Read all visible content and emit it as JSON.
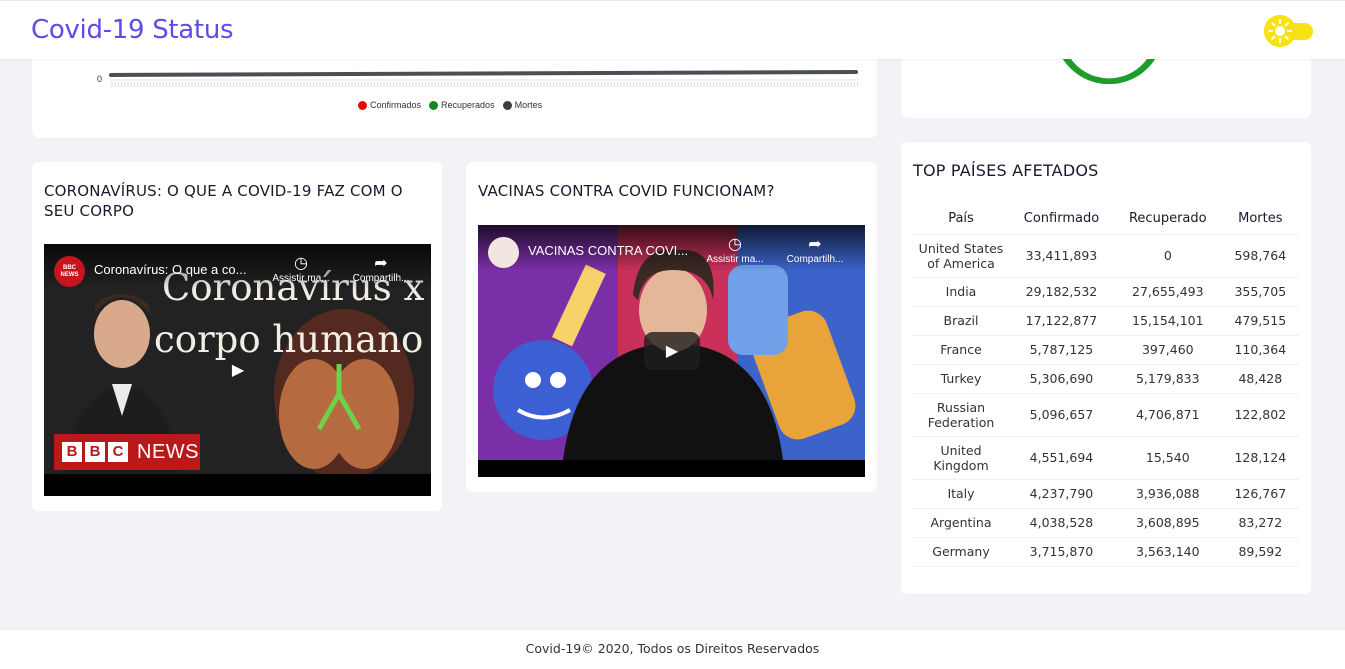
{
  "header": {
    "title": "Covid-19 Status",
    "theme_toggle": {
      "icon": "sun-icon",
      "state": "light"
    }
  },
  "chart_data": {
    "type": "line",
    "y_tick_labels": [
      "0"
    ],
    "series": [
      {
        "name": "Confirmados",
        "color": "#e30d0d"
      },
      {
        "name": "Recuperados",
        "color": "#148a1c"
      },
      {
        "name": "Mortes",
        "color": "#3b3f45"
      }
    ],
    "legend_placement": "bottom"
  },
  "donut": {
    "color": "#1e9d2b"
  },
  "videos": [
    {
      "heading": "CORONAVÍRUS: O QUE A COVID-19 FAZ COM O SEU CORPO",
      "player_title": "Coronavírus: O que a co...",
      "watch_later": "Assistir ma...",
      "share": "Compartilh...",
      "thumb_line1": "Coronavírus x",
      "thumb_line2": "corpo humano",
      "logo_letters": [
        "B",
        "B",
        "C"
      ],
      "logo_word": "NEWS",
      "channel_badge": "BBC NEWS"
    },
    {
      "heading": "VACINAS CONTRA COVID FUNCIONAM?",
      "player_title": "VACINAS CONTRA COVI...",
      "watch_later": "Assistir ma...",
      "share": "Compartilh..."
    }
  ],
  "top_countries": {
    "title": "TOP PAÍSES AFETADOS",
    "columns": [
      "País",
      "Confirmado",
      "Recuperado",
      "Mortes"
    ],
    "rows": [
      [
        "United States of America",
        "33,411,893",
        "0",
        "598,764"
      ],
      [
        "India",
        "29,182,532",
        "27,655,493",
        "355,705"
      ],
      [
        "Brazil",
        "17,122,877",
        "15,154,101",
        "479,515"
      ],
      [
        "France",
        "5,787,125",
        "397,460",
        "110,364"
      ],
      [
        "Turkey",
        "5,306,690",
        "5,179,833",
        "48,428"
      ],
      [
        "Russian Federation",
        "5,096,657",
        "4,706,871",
        "122,802"
      ],
      [
        "United Kingdom",
        "4,551,694",
        "15,540",
        "128,124"
      ],
      [
        "Italy",
        "4,237,790",
        "3,936,088",
        "126,767"
      ],
      [
        "Argentina",
        "4,038,528",
        "3,608,895",
        "83,272"
      ],
      [
        "Germany",
        "3,715,870",
        "3,563,140",
        "89,592"
      ]
    ]
  },
  "footer": {
    "text": "Covid-19© 2020, Todos os Direitos Reservados"
  }
}
